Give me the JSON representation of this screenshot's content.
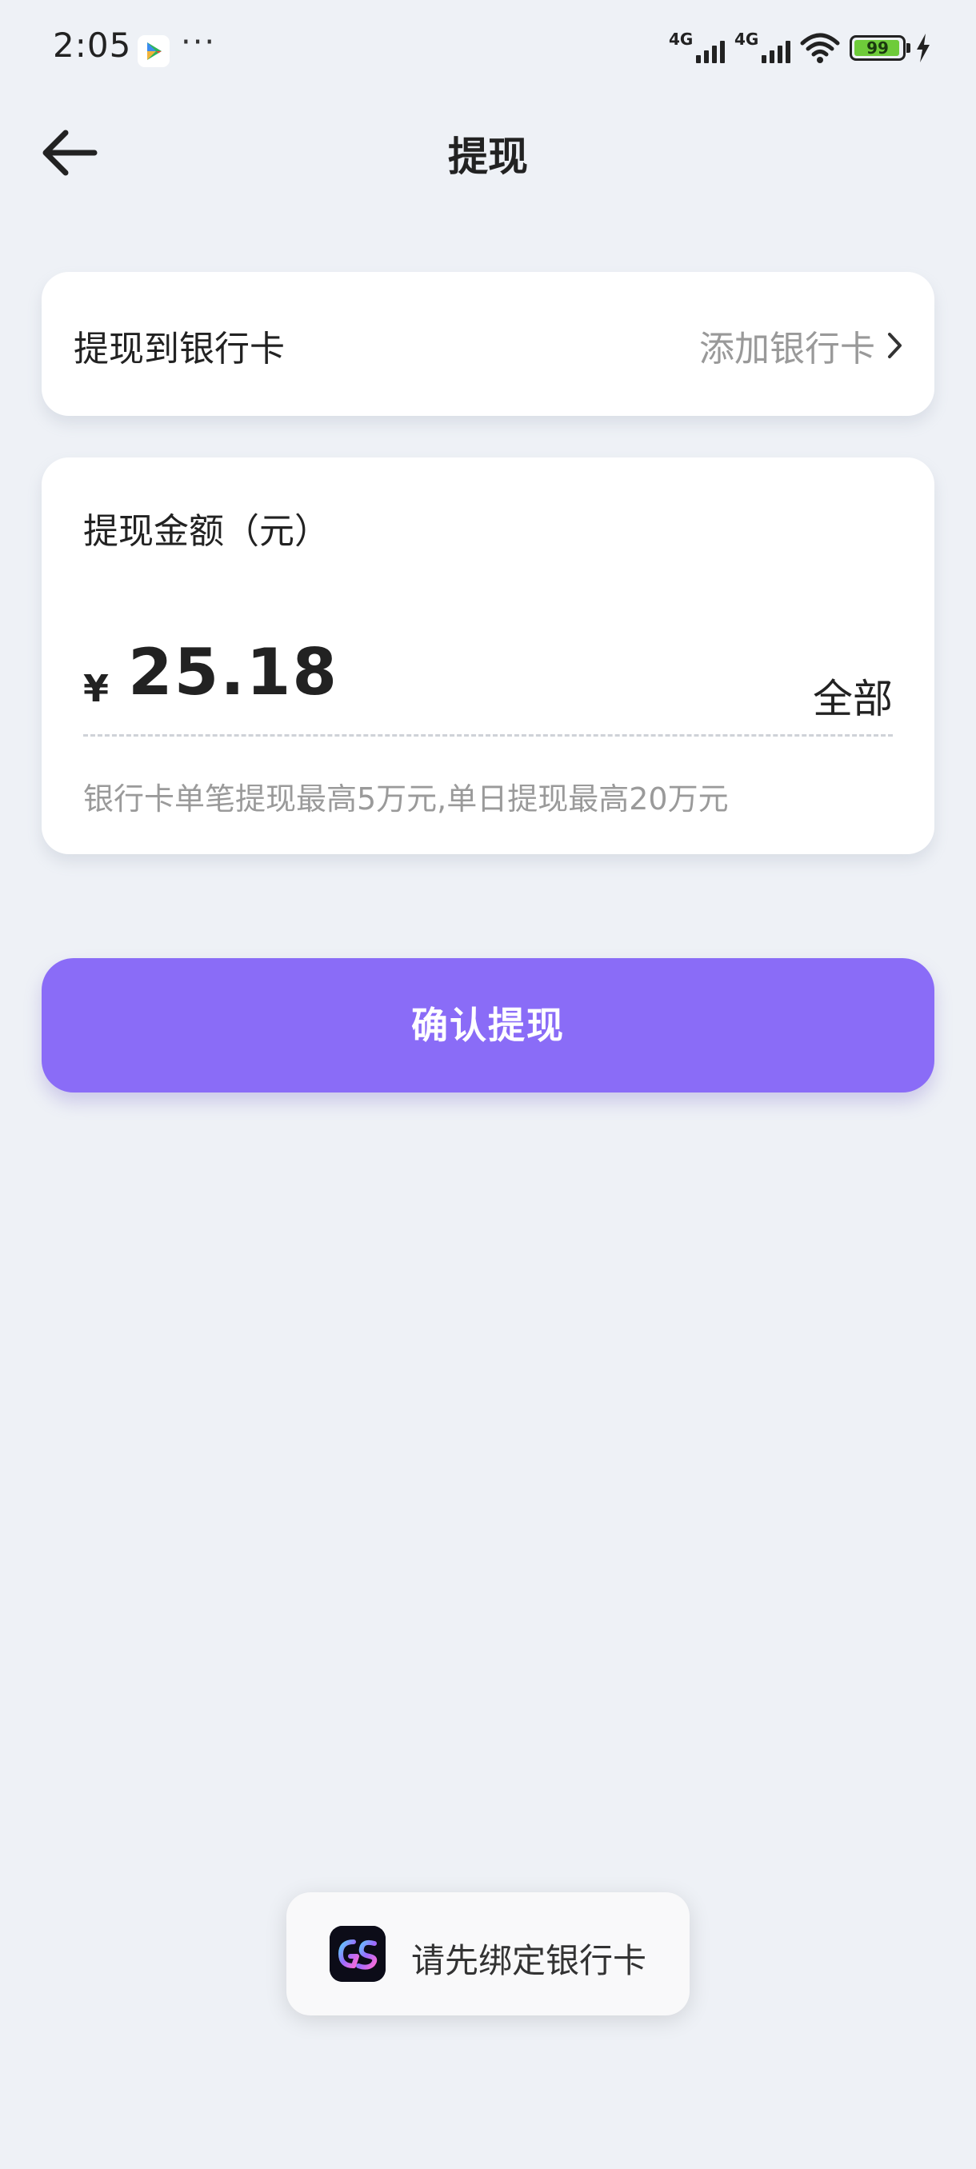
{
  "status_bar": {
    "time": "2:05",
    "overflow": "···",
    "network_1": "4G",
    "network_2": "4G",
    "battery": "99"
  },
  "header": {
    "title": "提现",
    "back_icon": "arrow-left-icon"
  },
  "bank_card": {
    "label": "提现到银行卡",
    "action": "添加银行卡",
    "action_icon": "chevron-right-icon"
  },
  "amount_card": {
    "title": "提现金额（元）",
    "currency": "¥",
    "amount": "25.18",
    "all_label": "全部",
    "limit_note": "银行卡单笔提现最高5万元,单日提现最高20万元"
  },
  "confirm_button": {
    "label": "确认提现"
  },
  "toast": {
    "message": "请先绑定银行卡",
    "icon": "app-logo-icon"
  },
  "colors": {
    "background": "#eef1f6",
    "accent": "#8a6cf7",
    "battery_fill": "#6ecb3a"
  }
}
